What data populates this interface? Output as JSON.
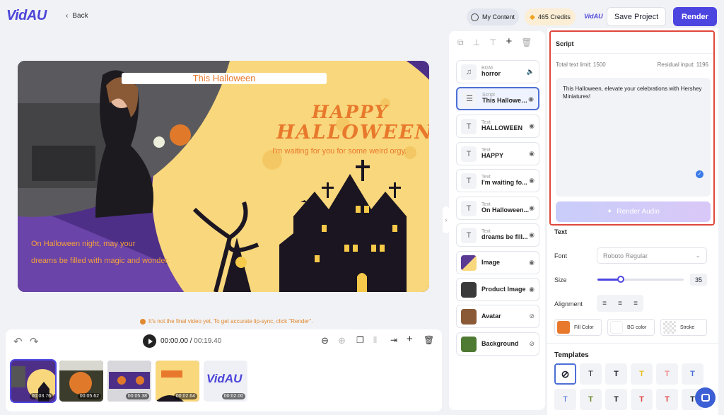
{
  "app": {
    "logo": "VidAU",
    "back_label": "Back",
    "mini_logo": "VidAU"
  },
  "header": {
    "my_content": "My Content",
    "credits": "465 Credits",
    "save_project": "Save Project",
    "render": "Render"
  },
  "canvas": {
    "title_overlay": "This Halloween",
    "headline_1": "HAPPY",
    "headline_2": "HALLOWEEN",
    "subline": "I'm waiting for you for some weird orgy.",
    "caption_1": "On Halloween night, may your",
    "caption_2": "dreams be filled with magic and wonder."
  },
  "hint": "It's not the final video yet, To get accurate lip-sync, click \"Render\".",
  "timeline": {
    "current_time": "00:00.00",
    "separator": "/",
    "total_time": "00:19.40",
    "thumbnails": [
      {
        "duration": "00:03.76",
        "active": true
      },
      {
        "duration": "00:05.62",
        "active": false
      },
      {
        "duration": "00:05.38",
        "active": false
      },
      {
        "duration": "00:02.64",
        "active": false
      },
      {
        "duration": "00:02.00",
        "active": false,
        "logo": "VidAU"
      }
    ]
  },
  "layers": [
    {
      "category": "BGM",
      "name": "horror",
      "icon": "music-note-icon",
      "status_icon": "volume-icon"
    },
    {
      "category": "Script",
      "name": "This Halloween, ...",
      "icon": "script-icon",
      "status_icon": "eye-icon",
      "selected": true
    },
    {
      "category": "Text",
      "name": "HALLOWEEN",
      "icon": "text-icon",
      "status_icon": "eye-icon"
    },
    {
      "category": "Text",
      "name": "HAPPY",
      "icon": "text-icon",
      "status_icon": "eye-icon"
    },
    {
      "category": "Text",
      "name": "I'm waiting fo...",
      "icon": "text-icon",
      "status_icon": "eye-icon"
    },
    {
      "category": "Text",
      "name": "On Halloween...",
      "icon": "text-icon",
      "status_icon": "eye-icon"
    },
    {
      "category": "Text",
      "name": "dreams be fill...",
      "icon": "text-icon",
      "status_icon": "eye-icon"
    },
    {
      "category": "",
      "name": "Image",
      "icon": "image-thumb",
      "status_icon": "eye-icon"
    },
    {
      "category": "",
      "name": "Product Image",
      "icon": "product-thumb",
      "status_icon": "eye-icon"
    },
    {
      "category": "",
      "name": "Avatar",
      "icon": "avatar-thumb",
      "status_icon": "eye-off-icon"
    },
    {
      "category": "",
      "name": "Background",
      "icon": "bg-thumb",
      "status_icon": "eye-off-icon"
    }
  ],
  "script_panel": {
    "title": "Script",
    "total_limit": "Total text limit: 1500",
    "residual": "Residual input: 1196",
    "text": "This Halloween, elevate your celebrations with Hershey Miniatures!",
    "render_audio": "Render Audio"
  },
  "text_panel": {
    "title": "Text",
    "font_label": "Font",
    "font_value": "Roboto Regular",
    "size_label": "Size",
    "size_value": "35",
    "size_fraction": 0.27,
    "alignment_label": "Alignment",
    "fill_color_label": "Fill Color",
    "bg_color_label": "BG color",
    "stroke_label": "Stroke",
    "fill_color": "#e8792c",
    "templates_title": "Templates"
  },
  "colors": {
    "accent": "#4d45e0",
    "highlight_border": "#e0463c",
    "orange_text": "#e8792c",
    "moon": "#fcd77a",
    "purple": "#5b3a93"
  }
}
